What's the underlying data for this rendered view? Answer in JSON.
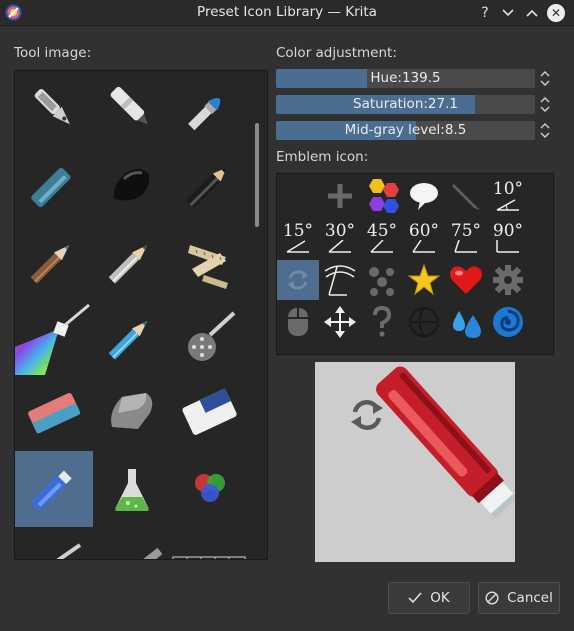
{
  "window": {
    "title": "Preset Icon Library — Krita",
    "help_label": "?",
    "minimize_label": "∨",
    "maximize_label": "∧",
    "close_label": "✕"
  },
  "tool_image": {
    "label": "Tool image:",
    "items": [
      "ink-pen",
      "marker-white",
      "brush-blue",
      "marker-teal",
      "blob-black",
      "pencil-black",
      "brush-brown",
      "pencil-grey",
      "tape-measure",
      "pen-prism",
      "pencil-blue",
      "airbrush-pen",
      "eraser-pink",
      "eraser-grey",
      "eraser-white",
      "eraser-pen-blue",
      "flask-green",
      "rgb-circles"
    ],
    "selected": "eraser-pen-blue"
  },
  "color_adjustment": {
    "label": "Color adjustment:",
    "sliders": [
      {
        "text": "Hue:139.5",
        "fraction": 0.35
      },
      {
        "text": "Saturation:27.1",
        "fraction": 0.77
      },
      {
        "text": "Mid-gray level:8.5",
        "fraction": 0.54
      }
    ]
  },
  "emblem": {
    "label": "Emblem icon:",
    "degree_labels": [
      "10°",
      "15°",
      "30°",
      "45°",
      "60°",
      "75°",
      "90°"
    ],
    "selected": "rotate-arrows"
  },
  "buttons": {
    "ok_label": "OK",
    "cancel_label": "Cancel"
  },
  "colors": {
    "accent": "#4f6e8f",
    "slider_fill": "#4a6e91",
    "background": "#313131"
  }
}
